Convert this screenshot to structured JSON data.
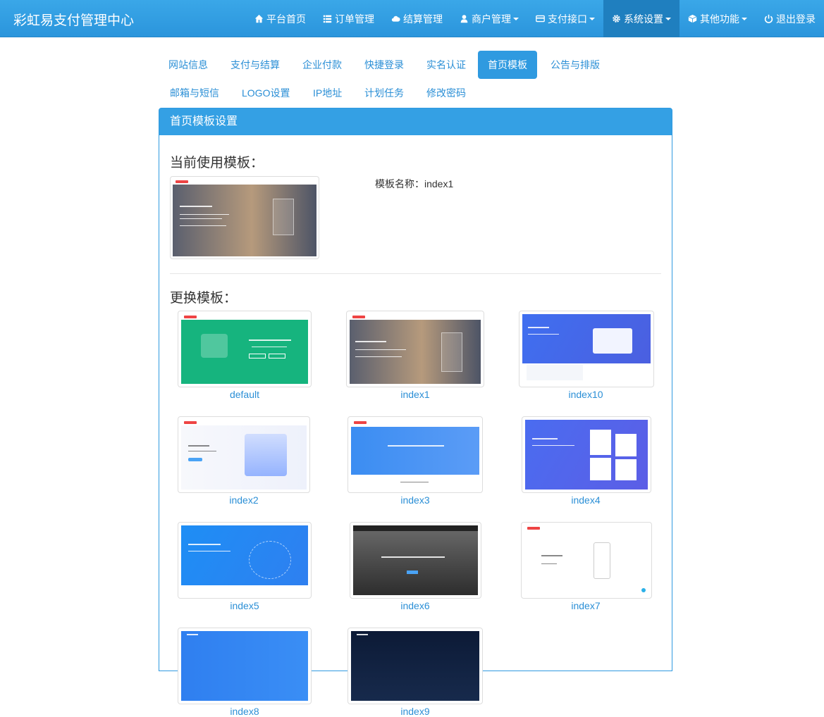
{
  "app": {
    "title": "彩虹易支付管理中心"
  },
  "nav": [
    {
      "label": "平台首页",
      "icon": "home-icon",
      "dropdown": false,
      "active": false
    },
    {
      "label": "订单管理",
      "icon": "list-icon",
      "dropdown": false,
      "active": false
    },
    {
      "label": "结算管理",
      "icon": "cloud-icon",
      "dropdown": false,
      "active": false
    },
    {
      "label": "商户管理",
      "icon": "user-icon",
      "dropdown": true,
      "active": false
    },
    {
      "label": "支付接口",
      "icon": "credit-card-icon",
      "dropdown": true,
      "active": false
    },
    {
      "label": "系统设置",
      "icon": "gear-icon",
      "dropdown": true,
      "active": true
    },
    {
      "label": "其他功能",
      "icon": "cube-icon",
      "dropdown": true,
      "active": false
    },
    {
      "label": "退出登录",
      "icon": "power-icon",
      "dropdown": false,
      "active": false
    }
  ],
  "tabs": [
    {
      "label": "网站信息"
    },
    {
      "label": "支付与结算"
    },
    {
      "label": "企业付款"
    },
    {
      "label": "快捷登录"
    },
    {
      "label": "实名认证"
    },
    {
      "label": "首页模板",
      "active": true
    },
    {
      "label": "公告与排版"
    },
    {
      "label": "邮箱与短信"
    },
    {
      "label": "LOGO设置"
    },
    {
      "label": "IP地址"
    },
    {
      "label": "计划任务"
    },
    {
      "label": "修改密码"
    }
  ],
  "panel": {
    "title": "首页模板设置",
    "current_title": "当前使用模板：",
    "current_name": "模板名称：index1",
    "change_title": "更换模板："
  },
  "templates": [
    {
      "name": "default"
    },
    {
      "name": "index1"
    },
    {
      "name": "index10"
    },
    {
      "name": "index2"
    },
    {
      "name": "index3"
    },
    {
      "name": "index4"
    },
    {
      "name": "index5"
    },
    {
      "name": "index6"
    },
    {
      "name": "index7"
    },
    {
      "name": "index8"
    },
    {
      "name": "index9"
    }
  ],
  "colors": {
    "primary": "#2f9ae0",
    "link": "#2b8fd6",
    "nav_active": "#1f7fbf"
  }
}
